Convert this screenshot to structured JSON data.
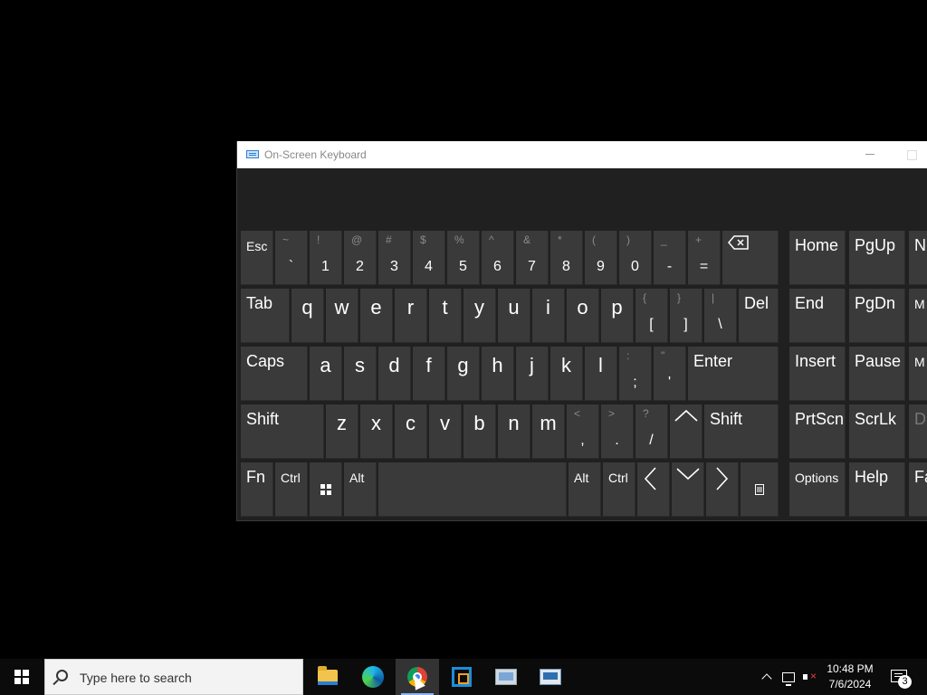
{
  "window": {
    "title": "On-Screen Keyboard"
  },
  "keys": {
    "row1": {
      "esc": "Esc",
      "backtick_top": "~",
      "backtick": "`",
      "n1_top": "!",
      "n1": "1",
      "n2_top": "@",
      "n2": "2",
      "n3_top": "#",
      "n3": "3",
      "n4_top": "$",
      "n4": "4",
      "n5_top": "%",
      "n5": "5",
      "n6_top": "^",
      "n6": "6",
      "n7_top": "&",
      "n7": "7",
      "n8_top": "*",
      "n8": "8",
      "n9_top": "(",
      "n9": "9",
      "n0_top": ")",
      "n0": "0",
      "minus_top": "_",
      "minus": "-",
      "equals_top": "+",
      "equals": "=",
      "backspace_icon": "backspace-icon",
      "home": "Home",
      "pgup": "PgUp",
      "nav_partial": "N"
    },
    "row2": {
      "tab": "Tab",
      "q": "q",
      "w": "w",
      "e": "e",
      "r": "r",
      "t": "t",
      "y": "y",
      "u": "u",
      "i": "i",
      "o": "o",
      "p": "p",
      "lbracket_top": "{",
      "lbracket": "[",
      "rbracket_top": "}",
      "rbracket": "]",
      "bslash_top": "|",
      "bslash": "\\",
      "del": "Del",
      "end": "End",
      "pgdn": "PgDn",
      "partial": "M"
    },
    "row3": {
      "caps": "Caps",
      "a": "a",
      "s": "s",
      "d": "d",
      "f": "f",
      "g": "g",
      "h": "h",
      "j": "j",
      "k": "k",
      "l": "l",
      "semi_top": ":",
      "semi": ";",
      "quote_top": "\"",
      "quote": "'",
      "enter": "Enter",
      "insert": "Insert",
      "pause": "Pause",
      "partial": "M"
    },
    "row4": {
      "shift_l": "Shift",
      "z": "z",
      "x": "x",
      "c": "c",
      "v": "v",
      "b": "b",
      "n": "n",
      "m": "m",
      "comma_top": "<",
      "comma": ",",
      "period_top": ">",
      "period": ".",
      "slash_top": "?",
      "slash": "/",
      "shift_r": "Shift",
      "prtscn": "PrtScn",
      "scrlk": "ScrLk",
      "partial": "D"
    },
    "row5": {
      "fn": "Fn",
      "ctrl_l": "Ctrl",
      "alt_l": "Alt",
      "alt_r": "Alt",
      "ctrl_r": "Ctrl",
      "options": "Options",
      "help": "Help",
      "partial": "Fa"
    }
  },
  "taskbar": {
    "search_placeholder": "Type here to search",
    "time": "10:48 PM",
    "date": "7/6/2024",
    "notification_count": "3",
    "apps": [
      "file-explorer-icon",
      "edge-icon",
      "chrome-icon",
      "virtualbox-icon",
      "remote-desktop-icon",
      "network-app-icon"
    ]
  }
}
